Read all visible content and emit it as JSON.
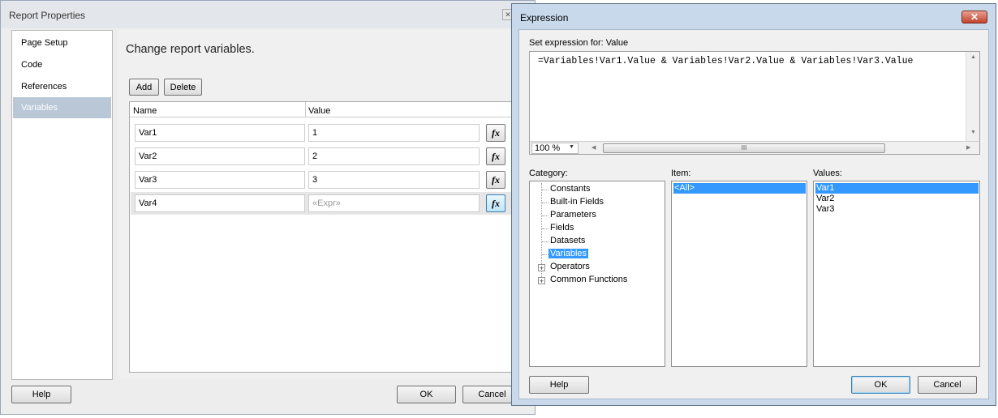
{
  "report_properties": {
    "title": "Report Properties",
    "nav": [
      "Page Setup",
      "Code",
      "References",
      "Variables"
    ],
    "selected_nav": "Variables",
    "heading": "Change report variables.",
    "add_label": "Add",
    "delete_label": "Delete",
    "columns": [
      "Name",
      "Value"
    ],
    "rows": [
      {
        "name": "Var1",
        "value": "1"
      },
      {
        "name": "Var2",
        "value": "2"
      },
      {
        "name": "Var3",
        "value": "3"
      },
      {
        "name": "Var4",
        "value": "«Expr»"
      }
    ],
    "fx_label": "fx",
    "help_label": "Help",
    "ok_label": "OK",
    "cancel_label": "Cancel"
  },
  "expression": {
    "title": "Expression",
    "close_label": "✕",
    "set_label": "Set expression for: Value",
    "text": "=Variables!Var1.Value & Variables!Var2.Value & Variables!Var3.Value",
    "zoom": "100 %",
    "scroll_grip": "III",
    "category_label": "Category:",
    "item_label": "Item:",
    "values_label": "Values:",
    "categories": [
      "Constants",
      "Built-in Fields",
      "Parameters",
      "Fields",
      "Datasets",
      "Variables",
      "Operators",
      "Common Functions"
    ],
    "selected_category": "Variables",
    "items": [
      "<All>"
    ],
    "values": [
      "Var1",
      "Var2",
      "Var3"
    ],
    "help_label": "Help",
    "ok_label": "OK",
    "cancel_label": "Cancel"
  }
}
